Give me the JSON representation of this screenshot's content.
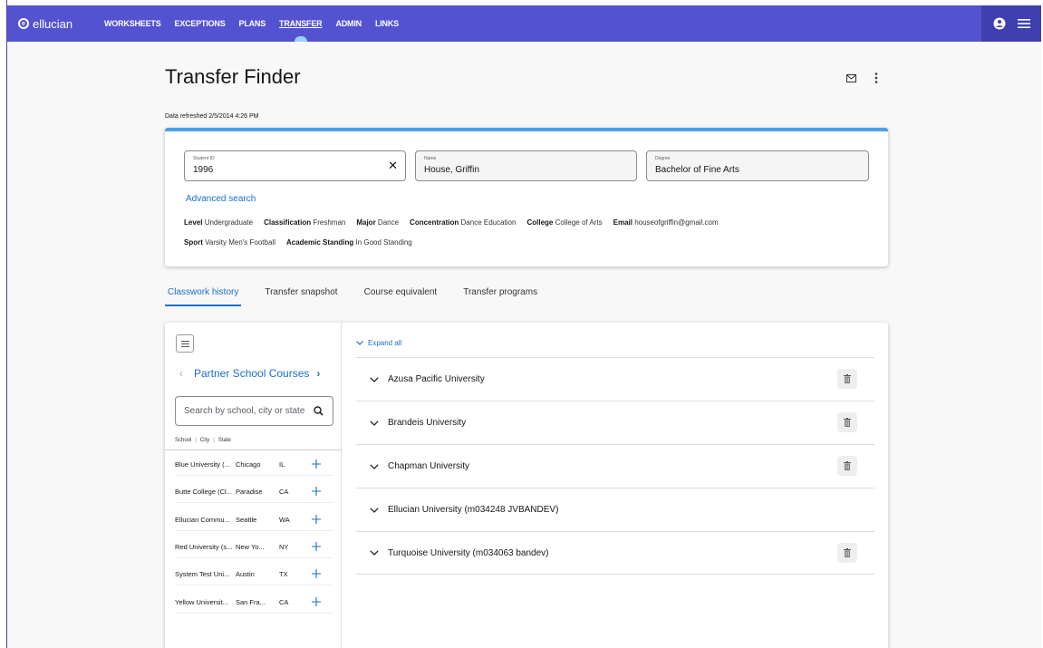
{
  "topbar": {
    "brand": "ellucian",
    "nav": [
      {
        "label": "WORKSHEETS",
        "active": false
      },
      {
        "label": "EXCEPTIONS",
        "active": false
      },
      {
        "label": "PLANS",
        "active": false
      },
      {
        "label": "TRANSFER",
        "active": true
      },
      {
        "label": "ADMIN",
        "active": false
      },
      {
        "label": "LINKS",
        "active": false
      }
    ],
    "icons": [
      "user-circle-icon",
      "hamburger-menu-icon"
    ]
  },
  "header": {
    "title": "Transfer Finder",
    "refreshed": "Data refreshed 2/5/2014 4:26 PM",
    "icons": [
      "mail-icon",
      "more-vertical-icon"
    ]
  },
  "student": {
    "id_label": "Student ID",
    "id_value": "1996",
    "name_label": "Name",
    "name_value": "House, Griffin",
    "degree_label": "Degree",
    "degree_value": "Bachelor of Fine Arts",
    "advanced_search": "Advanced search",
    "attrs_row1": [
      {
        "key": "Level",
        "value": "Undergraduate"
      },
      {
        "key": "Classification",
        "value": "Freshman"
      },
      {
        "key": "Major",
        "value": "Dance"
      },
      {
        "key": "Concentration",
        "value": "Dance Education"
      },
      {
        "key": "College",
        "value": "College of Arts"
      },
      {
        "key": "Email",
        "value": "houseofgriffin@gmail.com"
      }
    ],
    "attrs_row2": [
      {
        "key": "Sport",
        "value": "Varsity Men's Football"
      },
      {
        "key": "Academic Standing",
        "value": "In Good Standing"
      }
    ]
  },
  "tabs": [
    {
      "label": "Classwork history",
      "active": true
    },
    {
      "label": "Transfer snapshot",
      "active": false
    },
    {
      "label": "Course equivalent",
      "active": false
    },
    {
      "label": "Transfer programs",
      "active": false
    }
  ],
  "left_pane": {
    "pager_title": "Partner School Courses",
    "search_placeholder": "Search by school, city or state",
    "col_school": "School",
    "col_city": "City",
    "col_state": "State",
    "schools": [
      {
        "name": "Blue University (...",
        "city": "Chicago",
        "state": "IL"
      },
      {
        "name": "Butte College (Cl...",
        "city": "Paradise",
        "state": "CA"
      },
      {
        "name": "Ellucian Commu...",
        "city": "Seattle",
        "state": "WA"
      },
      {
        "name": "Red University (s...",
        "city": "New Yo...",
        "state": "NY"
      },
      {
        "name": "System Test Uni...",
        "city": "Austin",
        "state": "TX"
      },
      {
        "name": "Yellow Universit...",
        "city": "San Fra...",
        "state": "CA"
      }
    ]
  },
  "right_pane": {
    "expand_all": "Expand all",
    "universities": [
      {
        "name": "Azusa Pacific University",
        "deletable": true
      },
      {
        "name": "Brandeis University",
        "deletable": true
      },
      {
        "name": "Chapman University",
        "deletable": true
      },
      {
        "name": "Ellucian University (m034248 JVBANDEV)",
        "deletable": false
      },
      {
        "name": "Turquoise University (m034063 bandev)",
        "deletable": true
      }
    ]
  },
  "colors": {
    "topbar": "#5353d1",
    "accent_blue": "#1a6fc9",
    "card_top_border": "#4aa2e8"
  }
}
